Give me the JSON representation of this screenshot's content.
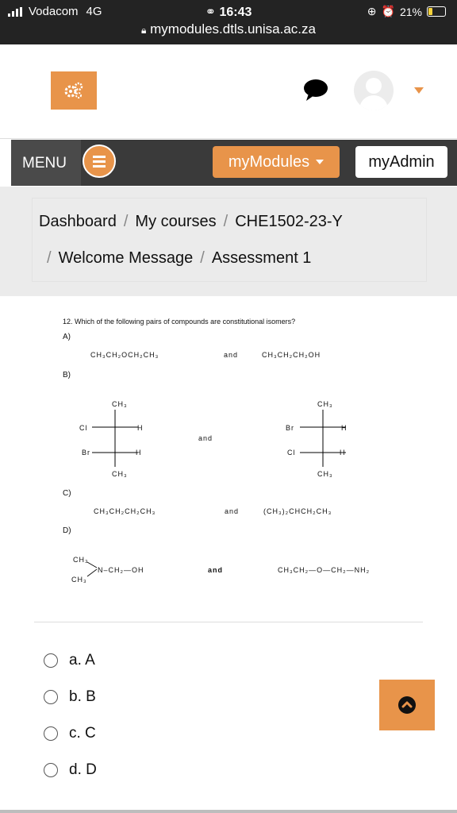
{
  "status": {
    "carrier": "Vodacom",
    "network": "4G",
    "time": "16:43",
    "battery": "21%",
    "url": "mymodules.dtls.unisa.ac.za"
  },
  "nav": {
    "menu_label": "MENU",
    "mymodules_label": "myModules",
    "myadmin_label": "myAdmin"
  },
  "breadcrumb": {
    "dashboard": "Dashboard",
    "courses": "My courses",
    "course": "CHE1502-23-Y",
    "welcome": "Welcome Message",
    "assessment": "Assessment 1"
  },
  "question": {
    "title": "12. Which of the following pairs of compounds are constitutional isomers?",
    "labels": [
      "A)",
      "B)",
      "C)",
      "D)"
    ],
    "a_left": "CH₃CH₂OCH₂CH₃",
    "a_right": "CH₃CH₂CH₂OH",
    "and": "and",
    "b_top": "CH₃",
    "b_bottom": "CH₃",
    "b_cl": "Cl",
    "b_br": "Br",
    "b_h": "H",
    "c_left": "CH₃CH₂CH₂CH₃",
    "c_right": "(CH₃)₂CHCH₂CH₃",
    "d_ch3": "CH₃",
    "d_left_chain": "N–CH₂—OH",
    "d_right": "CH₃CH₂—O—CH₂—NH₂"
  },
  "answers": [
    "a. A",
    "b. B",
    "c. C",
    "d. D"
  ],
  "colors": {
    "accent": "#e8944a",
    "navbar": "#3a3a3a",
    "statusbar": "#232323"
  }
}
